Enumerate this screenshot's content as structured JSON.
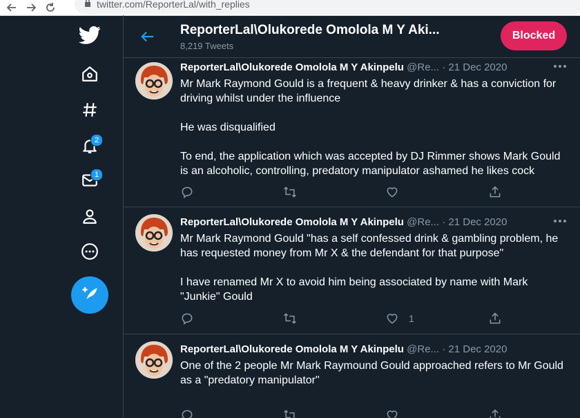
{
  "browser": {
    "url": "twitter.com/ReporterLal/with_replies"
  },
  "sidebar": {
    "icons": [
      "twitter-logo-icon",
      "home-icon",
      "explore-hashtag-icon",
      "notifications-bell-icon",
      "messages-mail-icon",
      "profile-icon",
      "more-circle-icon",
      "compose-tweet-icon"
    ],
    "notifications_badge": "2",
    "messages_badge": "1"
  },
  "header": {
    "name": "ReporterLal\\Olukorede Omolola M Y Aki...",
    "tweet_count": "8,219 Tweets",
    "blocked_label": "Blocked"
  },
  "tweets": [
    {
      "name": "ReporterLal\\Olukorede Omolola M Y Akinpelu",
      "handle": "@Re...",
      "dot": "·",
      "date": "21 Dec 2020",
      "paragraphs": [
        "Mr Mark Raymond Gould is a frequent & heavy drinker & has a conviction for driving whilst under the influence",
        "He was disqualified",
        "To end, the application which was accepted by DJ Rimmer shows Mark Gould is an alcoholic, controlling, predatory manipulator ashamed he likes cock"
      ],
      "like_count": ""
    },
    {
      "name": "ReporterLal\\Olukorede Omolola M Y Akinpelu",
      "handle": "@Re...",
      "dot": "·",
      "date": "21 Dec 2020",
      "paragraphs": [
        "Mr Mark Raymond Gould \"has a self confessed drink & gambling problem, he has requested money from Mr X & the defendant for that purpose\"",
        "I have renamed Mr X to avoid him being associated by name with Mark \"Junkie\" Gould"
      ],
      "like_count": "1"
    },
    {
      "name": "ReporterLal\\Olukorede Omolola M Y Akinpelu",
      "handle": "@Re...",
      "dot": "·",
      "date": "21 Dec 2020",
      "paragraphs": [
        "One of the 2 people Mr Mark Raymound Gould approached refers to Mr Gould as a \"predatory manipulator\""
      ],
      "like_count": ""
    }
  ],
  "colors": {
    "background": "#15202b",
    "accent": "#1d9bf0",
    "blocked": "#e0245e",
    "muted": "#8899a6",
    "border": "#38444d"
  }
}
